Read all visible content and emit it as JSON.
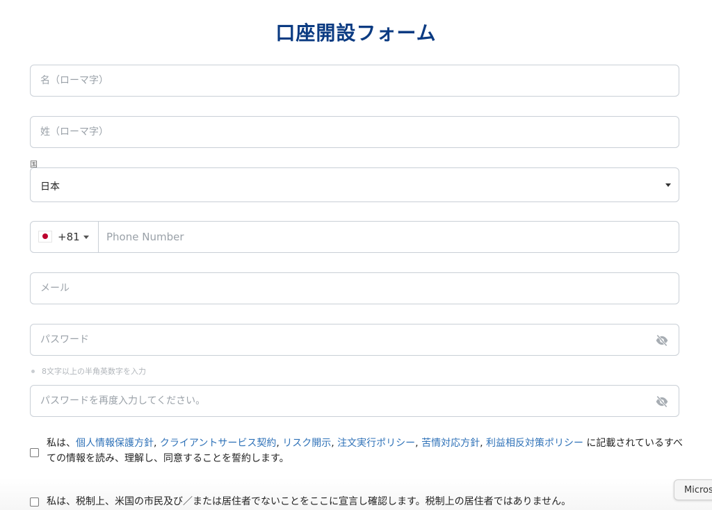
{
  "form": {
    "title": "口座開設フォーム",
    "first_name_placeholder": "名（ローマ字）",
    "last_name_placeholder": "姓（ローマ字）",
    "country_label": "国",
    "country_value": "日本",
    "phone_dial_code": "+81",
    "phone_flag": "japan-flag-icon",
    "phone_placeholder": "Phone Number",
    "email_placeholder": "メール",
    "password_placeholder": "パスワード",
    "password_hint": "8文字以上の半角英数字を入力",
    "password_confirm_placeholder": "パスワードを再度入力してください。",
    "password_toggle_icon": "eye-slash-icon"
  },
  "agreements": {
    "terms": {
      "prefix": "私は、",
      "links": [
        "個人情報保護方針",
        "クライアントサービス契約",
        "リスク開示",
        "注文実行ポリシー",
        "苦情対応方針",
        "利益相反対策ポリシー"
      ],
      "suffix": " に記載されているすべての情報を読み、理解し、同意することを誓約します。"
    },
    "tax_declaration": "私は、税制上、米国の市民及び／または居住者でないことをここに宣言し確認します。税制上の居住者ではありません。"
  },
  "overlay": {
    "chip_label": "Micros"
  },
  "colors": {
    "title": "#0b3b82",
    "link": "#2f72b8",
    "border": "#c9cfd6",
    "placeholder": "#9aa1a8"
  }
}
